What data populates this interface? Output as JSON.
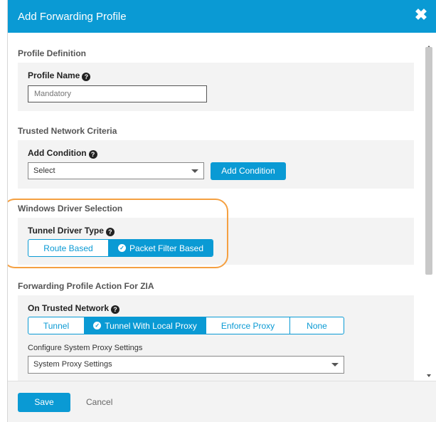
{
  "dialog": {
    "title": "Add Forwarding Profile",
    "close_glyph": "✖"
  },
  "profile_definition": {
    "section_title": "Profile Definition",
    "name_label": "Profile Name",
    "name_placeholder": "Mandatory",
    "name_value": ""
  },
  "trusted_network": {
    "section_title": "Trusted Network Criteria",
    "condition_label": "Add Condition",
    "select_value": "Select",
    "add_button": "Add Condition"
  },
  "windows_driver": {
    "section_title": "Windows Driver Selection",
    "tunnel_label": "Tunnel Driver Type",
    "options": [
      {
        "label": "Route Based",
        "active": false
      },
      {
        "label": "Packet Filter Based",
        "active": true
      }
    ]
  },
  "zia_action": {
    "section_title": "Forwarding Profile Action For ZIA",
    "trusted_label": "On Trusted Network",
    "options": [
      {
        "label": "Tunnel",
        "active": false
      },
      {
        "label": "Tunnel With Local Proxy",
        "active": true
      },
      {
        "label": "Enforce Proxy",
        "active": false
      },
      {
        "label": "None",
        "active": false
      }
    ],
    "proxy_label": "Configure System Proxy Settings",
    "proxy_select_value": "System Proxy Settings"
  },
  "footer": {
    "save": "Save",
    "cancel": "Cancel"
  },
  "help_glyph": "?",
  "check_glyph": "✓",
  "colors": {
    "accent": "#0a9ad4",
    "highlight": "#f5a041",
    "panel": "#f3f3f3"
  }
}
